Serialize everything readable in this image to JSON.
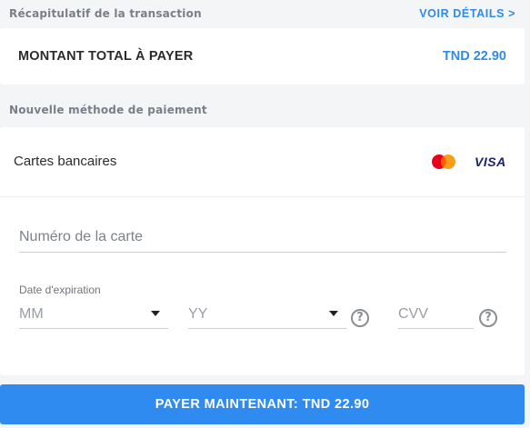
{
  "summary": {
    "title": "Récapitulatif de la transaction",
    "details_link": "VOIR DÉTAILS >"
  },
  "total": {
    "label": "MONTANT TOTAL À PAYER",
    "amount": "TND 22.90"
  },
  "payment_method": {
    "title": "Nouvelle méthode de paiement",
    "card_type_label": "Cartes bancaires",
    "brands": [
      "mastercard-icon",
      "visa-icon"
    ],
    "visa_text": "VISA"
  },
  "form": {
    "card_number_placeholder": "Numéro de la carte",
    "expiry_label": "Date d'expiration",
    "month_value": "MM",
    "year_value": "YY",
    "cvv_placeholder": "CVV",
    "help_glyph": "?"
  },
  "pay_button": {
    "label": "PAYER MAINTENANT: TND 22.90"
  },
  "colors": {
    "accent": "#2f8be6",
    "button": "#2f8bf0",
    "background": "#f4f5f7"
  }
}
